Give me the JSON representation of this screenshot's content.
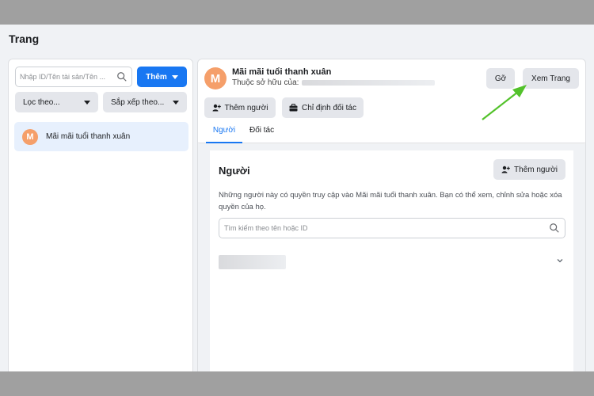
{
  "page": {
    "title": "Trang"
  },
  "sidebar": {
    "search_placeholder": "Nhập ID/Tên tài sản/Tên ...",
    "add_button": "Thêm",
    "filter_label": "Lọc theo...",
    "sort_label": "Sắp xếp theo...",
    "pages": [
      {
        "initial": "M",
        "name": "Mãi mãi tuổi thanh xuân"
      }
    ]
  },
  "detail": {
    "avatar_initial": "M",
    "name": "Mãi mãi tuổi thanh xuân",
    "owner_label": "Thuộc sở hữu của:",
    "remove_button": "Gỡ",
    "view_button": "Xem Trang",
    "add_people_button": "Thêm người",
    "assign_partner_button": "Chỉ định đối tác",
    "tabs": [
      {
        "label": "Người",
        "active": true
      },
      {
        "label": "Đối tác",
        "active": false
      }
    ]
  },
  "people": {
    "title": "Người",
    "add_button": "Thêm người",
    "description": "Những người này có quyền truy cập vào Mãi mãi tuổi thanh xuân. Bạn có thể xem, chỉnh sửa hoặc xóa quyền của họ.",
    "search_placeholder": "Tìm kiếm theo tên hoặc ID"
  },
  "colors": {
    "accent": "#1877f2",
    "avatar": "#f59f6a",
    "arrow": "#53c22b",
    "selected_bg": "#e7f0fd"
  }
}
